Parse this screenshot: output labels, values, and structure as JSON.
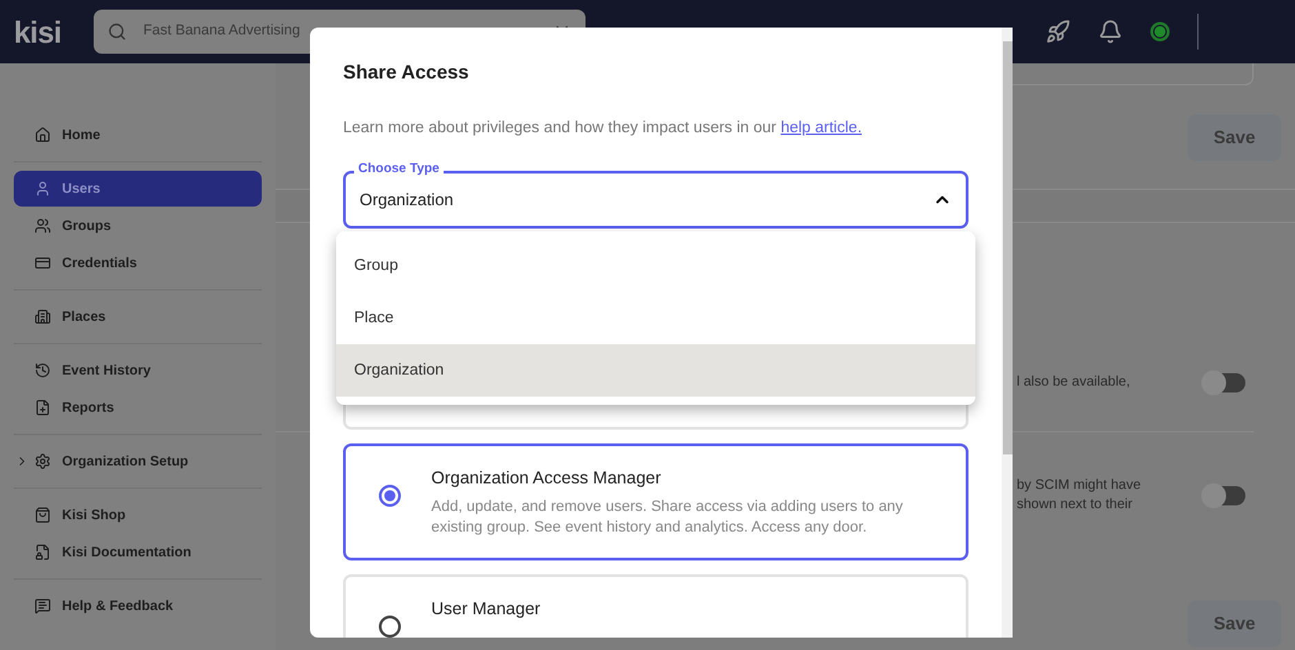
{
  "topbar": {
    "logo": "kisi",
    "search": {
      "value": "Fast Banana Advertising"
    }
  },
  "sidebar": {
    "groups": [
      [
        {
          "label": "Home",
          "selected": false
        }
      ],
      [
        {
          "label": "Users",
          "selected": true
        },
        {
          "label": "Groups",
          "selected": false
        },
        {
          "label": "Credentials",
          "selected": false
        }
      ],
      [
        {
          "label": "Places",
          "selected": false
        }
      ],
      [
        {
          "label": "Event History",
          "selected": false
        },
        {
          "label": "Reports",
          "selected": false
        }
      ],
      [
        {
          "label": "Organization Setup",
          "selected": false,
          "expanded": false
        }
      ],
      [
        {
          "label": "Kisi Shop",
          "selected": false
        },
        {
          "label": "Kisi Documentation",
          "selected": false
        }
      ],
      [
        {
          "label": "Help & Feedback",
          "selected": false
        }
      ]
    ]
  },
  "main": {
    "save_buttons": [
      "Save",
      "Save"
    ],
    "settings": [
      {
        "lines": [
          "l also be available,"
        ],
        "on": false
      },
      {
        "lines": [
          "by SCIM might have",
          "shown next to their"
        ],
        "on": false
      }
    ]
  },
  "modal": {
    "title": "Share Access",
    "description": {
      "text": "Learn more about privileges and how they impact users in our ",
      "link": "help article."
    },
    "select": {
      "label": "Choose Type",
      "value": "Organization",
      "expanded": true
    },
    "options": [
      {
        "label": "Group",
        "selected": false
      },
      {
        "label": "Place",
        "selected": false
      },
      {
        "label": "Organization",
        "selected": true
      }
    ],
    "roles": [
      {
        "title": "Organization Access Manager",
        "description": "Add, update, and remove users. Share access via adding users to any existing group. See event history and analytics. Access any door.",
        "selected": true
      },
      {
        "title": "User Manager",
        "selected": false
      }
    ]
  }
}
